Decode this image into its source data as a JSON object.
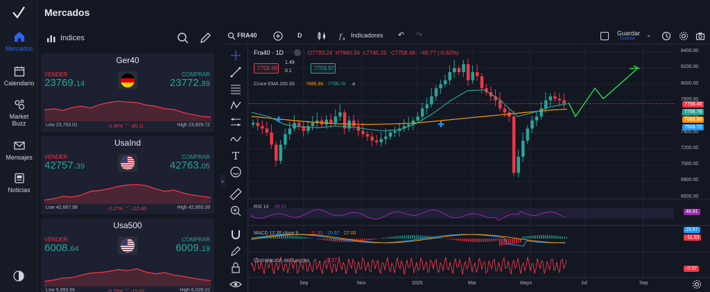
{
  "app": {
    "title": "Mercados"
  },
  "nav": [
    {
      "label": "Mercados",
      "icon": "home-icon",
      "active": true
    },
    {
      "label": "Calendario",
      "icon": "calendar-icon"
    },
    {
      "label": "Market Buzz",
      "icon": "bubbles-icon"
    },
    {
      "label": "Mensajes",
      "icon": "mail-icon"
    },
    {
      "label": "Noticias",
      "icon": "news-icon"
    }
  ],
  "panel": {
    "title": "Indices"
  },
  "cards": [
    {
      "name": "Ger40",
      "sell_label": "VENDER",
      "buy_label": "COMPRAR",
      "sell_main": "23769.",
      "sell_small": "14",
      "buy_main": "23772.",
      "buy_small": "89",
      "low": "Low 23,753.01",
      "change": "-0.36% ﹀ -85.11",
      "high": "High 23,829.72",
      "flag": "de",
      "spark": [
        0.6,
        0.55,
        0.62,
        0.5,
        0.45,
        0.52,
        0.38,
        0.3,
        0.25,
        0.28,
        0.3,
        0.4,
        0.45,
        0.55,
        0.58,
        0.7,
        0.78,
        0.85,
        0.88
      ]
    },
    {
      "name": "UsaInd",
      "sell_label": "VENDER",
      "buy_label": "COMPRAR",
      "sell_main": "42757.",
      "sell_small": "39",
      "buy_main": "42763.",
      "buy_small": "05",
      "low": "Low 42,667.98",
      "change": "-0.27% ﹀ -115.80",
      "high": "High 42,893.39",
      "flag": "us",
      "spark": [
        0.9,
        0.85,
        0.75,
        0.78,
        0.7,
        0.55,
        0.52,
        0.45,
        0.35,
        0.3,
        0.28,
        0.32,
        0.45,
        0.55,
        0.5,
        0.62,
        0.7,
        0.75,
        0.8
      ]
    },
    {
      "name": "Usa500",
      "sell_label": "VENDER",
      "buy_label": "COMPRAR",
      "sell_main": "6008.",
      "sell_small": "64",
      "buy_main": "6009.",
      "buy_small": "19",
      "low": "Low 5,993.66",
      "change": "-0.26% ﹀ -15.69",
      "high": "High 6,028.31",
      "flag": "us",
      "spark": [
        0.85,
        0.8,
        0.72,
        0.7,
        0.6,
        0.52,
        0.5,
        0.45,
        0.38,
        0.42,
        0.35,
        0.48,
        0.55,
        0.5,
        0.6,
        0.65,
        0.72,
        0.78,
        0.82
      ]
    }
  ],
  "toolbar": {
    "symbol": "FRA40",
    "interval": "D",
    "indicators": "Indicadores",
    "save": "Guardar",
    "save_sub": "Guardar"
  },
  "chart": {
    "legend_symbol": "Fra40 · 1D",
    "o": "O7793.24",
    "h": "H7840.34",
    "l": "L7745.15",
    "c": "C7758.48",
    "chg": "-48.77 (-0.62%)",
    "sell_price": "7758.48",
    "spread": "1.49",
    "qty": "0.1",
    "buy_price": "7759.97",
    "ema_label": "Cruce EMA 200 50",
    "ema1": "7686.96",
    "ema2": "7756.78",
    "ema_flag": "ø",
    "rsi_label": "RSI 14",
    "rsi_val": "48.91",
    "macd_label": "MACD 12 26 close 9",
    "macd_v1": "-11.33",
    "macd_v2": "15.67",
    "macd_v3": "27.00",
    "corr_label": "Correlación de fuerzas",
    "corr_val": "-0.37",
    "y_ticks": [
      "8400.00",
      "8200.00",
      "8000.00",
      "7800.00",
      "7600.00",
      "7400.00",
      "7200.00",
      "7000.00",
      "6800.00",
      "6600.00"
    ],
    "x_ticks": [
      "Sep",
      "Nov",
      "2025",
      "Mar",
      "Mayo",
      "Jul",
      "Sep"
    ],
    "axis_labels": [
      {
        "text": "7758.48",
        "color": "#f23645"
      },
      {
        "text": "7756.78",
        "color": "#26a69a"
      },
      {
        "text": "7686.96",
        "color": "#ff9800"
      },
      {
        "text": "7508.72",
        "color": "#2196f3"
      }
    ],
    "rsi_axis": "48.91",
    "macd_axis1": "15.67",
    "macd_axis2": "-11.33",
    "corr_axis": "-0.37"
  }
}
